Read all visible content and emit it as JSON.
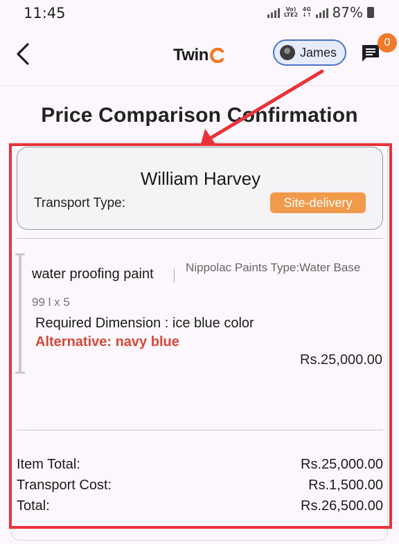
{
  "status_bar": {
    "time": "11:45",
    "network_label_top": "Vo)",
    "network_label_bottom": "LTE2",
    "data_label_top": "4G",
    "data_label_bottom": "↓↑",
    "battery_percent": "87%"
  },
  "app_bar": {
    "logo_text": "Twin",
    "user_name": "James",
    "chat_badge_count": "0"
  },
  "page": {
    "title": "Price Comparison Confirmation"
  },
  "supplier": {
    "name": "William Harvey",
    "transport_label": "Transport Type:",
    "transport_value": "Site-delivery"
  },
  "item": {
    "name": "water proofing paint",
    "brand_type": "Nippolac Paints  Type:Water Base",
    "quantity": "99 l x 5",
    "required_dimension": "Required Dimension : ice blue color",
    "alternative": "Alternative: navy blue",
    "price": "Rs.25,000.00"
  },
  "totals": [
    {
      "label": "Item Total:",
      "value": "Rs.25,000.00"
    },
    {
      "label": "Transport Cost:",
      "value": "Rs.1,500.00"
    },
    {
      "label": "Total:",
      "value": "Rs.26,500.00"
    }
  ],
  "colors": {
    "accent_orange": "#f07a2a",
    "badge_orange": "#f09a4a",
    "alternative_red": "#d24a3a",
    "annotation_red": "#e8323a",
    "chip_border_blue": "#4a74c9"
  }
}
